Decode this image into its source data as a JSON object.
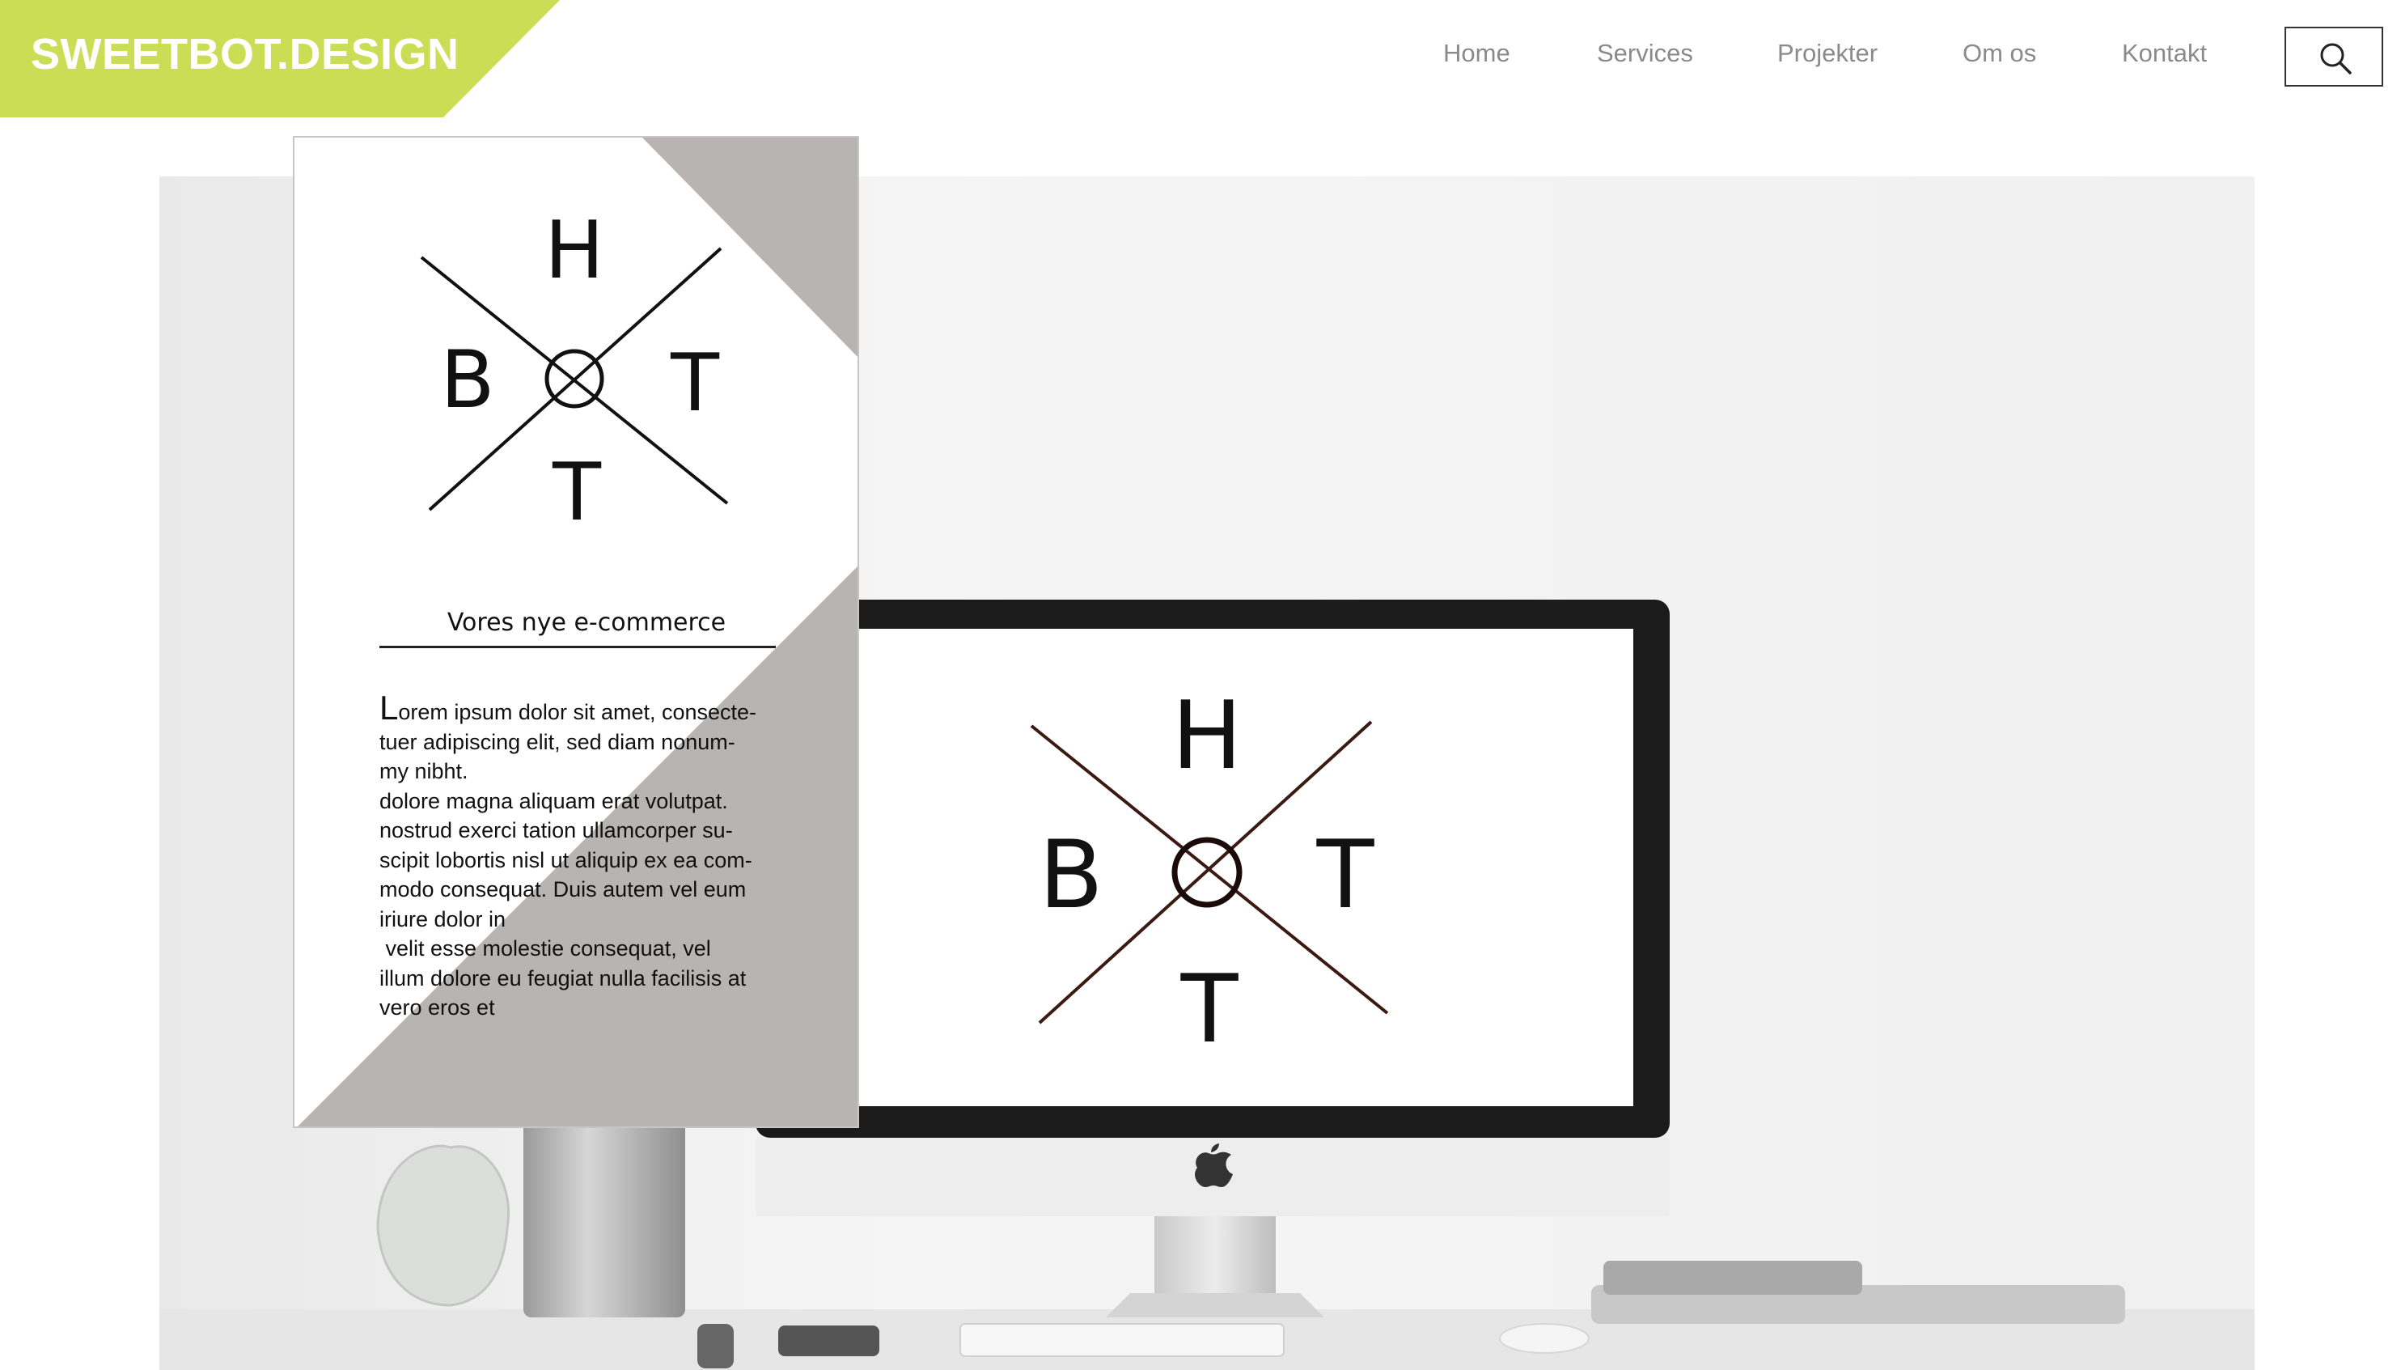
{
  "brand": {
    "name": "SWEETBOT.DESIGN",
    "color": "#c9dd55"
  },
  "nav": {
    "items": [
      {
        "label": "Home"
      },
      {
        "label": "Services"
      },
      {
        "label": "Projekter"
      },
      {
        "label": "Om os"
      },
      {
        "label": "Kontakt"
      }
    ],
    "search_icon": "search-icon"
  },
  "card": {
    "monogram": {
      "top": "H",
      "left": "B",
      "right": "T",
      "bottom": "T"
    },
    "title": "Vores nye e-commerce",
    "body_first_letter": "L",
    "body_lines": [
      "orem ipsum dolor sit amet, consecte-",
      "tuer adipiscing elit, sed diam nonum-",
      "my nibht.",
      "dolore magna aliquam erat volutpat.",
      "nostrud exerci tation ullamcorper su-",
      "scipit lobortis nisl ut aliquip ex ea com-",
      "modo consequat. Duis autem vel eum",
      "iriure dolor in",
      " velit esse molestie consequat, vel",
      "illum dolore eu feugiat nulla facilisis at",
      "vero eros et"
    ],
    "accent_color": "#b7b4b1"
  },
  "screen": {
    "monogram": {
      "top": "H",
      "left": "B",
      "right": "T",
      "bottom": "T"
    }
  }
}
